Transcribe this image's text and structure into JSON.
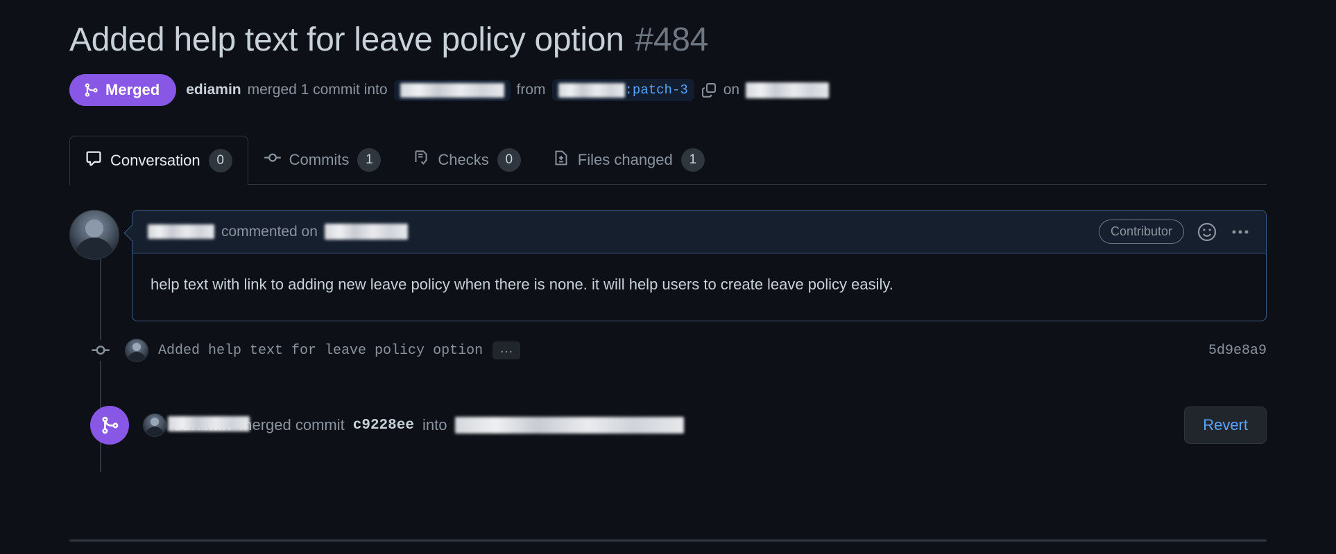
{
  "header": {
    "title": "Added help text for leave policy option",
    "number": "#484"
  },
  "status": {
    "badge_label": "Merged",
    "badge_color": "#8957e5",
    "merge_actor": "ediamin",
    "merge_text": "merged 1 commit into",
    "from_label": "from",
    "head_branch_suffix": ":patch-3",
    "on_label": "on",
    "base_branch_redacted": "",
    "head_branch_redacted": "",
    "date_redacted": ""
  },
  "tabs": [
    {
      "label": "Conversation",
      "count": "0",
      "icon": "comment-icon",
      "active": true
    },
    {
      "label": "Commits",
      "count": "1",
      "icon": "commit-icon",
      "active": false
    },
    {
      "label": "Checks",
      "count": "0",
      "icon": "checks-icon",
      "active": false
    },
    {
      "label": "Files changed",
      "count": "1",
      "icon": "file-diff-icon",
      "active": false
    }
  ],
  "comment": {
    "author_redacted": "",
    "commented_on": "commented on",
    "date_redacted": "",
    "contributor_label": "Contributor",
    "body": "help text with link to adding new leave policy when there is none. it will help users to create leave policy easily."
  },
  "commit": {
    "message": "Added help text for leave policy option",
    "ellipsis": "…",
    "sha": "5d9e8a9"
  },
  "merged_event": {
    "actor_redacted": "",
    "actor_visible": "ediamin",
    "merged_text": "merged commit",
    "commit_sha": "c9228ee",
    "into_text": "into",
    "target_redacted": "",
    "revert_label": "Revert"
  }
}
